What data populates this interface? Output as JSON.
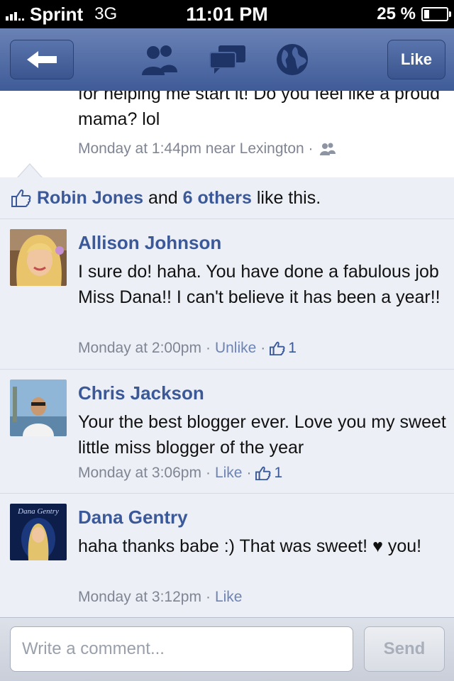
{
  "status_bar": {
    "carrier": "Sprint",
    "network": "3G",
    "time": "11:01 PM",
    "battery": "25 %"
  },
  "nav": {
    "like_label": "Like",
    "icons": [
      "back-arrow-icon",
      "friends-icon",
      "messages-icon",
      "globe-icon"
    ]
  },
  "post": {
    "text": "for helping me start it! Do you feel like a proud mama? lol",
    "meta": "Monday at 1:44pm near Lexington ·"
  },
  "likes_summary": {
    "first": "Robin Jones",
    "and": " and ",
    "others": "6 others",
    "suffix": " like this."
  },
  "comments": [
    {
      "author": "Allison Johnson",
      "text": "I sure do! haha. You have done a fabulous job Miss Dana!! I can't believe it has been a year!!",
      "time": "Monday at 2:00pm",
      "action": "Unlike",
      "likes": "1"
    },
    {
      "author": "Chris Jackson",
      "text": "Your the best blogger ever. Love you my sweet little miss blogger of the year",
      "time": "Monday at 3:06pm",
      "action": "Like",
      "likes": "1"
    },
    {
      "author": "Dana Gentry",
      "text": "haha thanks babe :) That was sweet! ♥ you!",
      "time": "Monday at 3:12pm",
      "action": "Like",
      "avatar_text": "Dana Gentry"
    }
  ],
  "composer": {
    "placeholder": "Write a comment...",
    "send_label": "Send"
  },
  "colors": {
    "link": "#3b5998",
    "nav": "#4a65a0",
    "background": "#eceff5"
  }
}
